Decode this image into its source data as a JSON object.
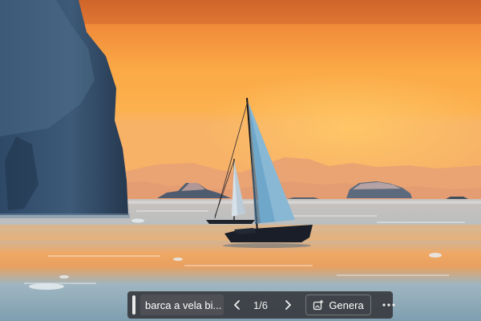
{
  "image": {
    "subject": "sailboat-at-sunset-among-icebergs",
    "colors": {
      "sky_top": "#e27a2f",
      "sky_glow": "#fbb24f",
      "mountains": "#e79a6e",
      "sea": "#9db3be",
      "iceberg": "#253a52"
    }
  },
  "toolbar": {
    "query_text": "barca a vela bi...",
    "prev_icon": "chevron-left-icon",
    "counter": "1/6",
    "next_icon": "chevron-right-icon",
    "generate_icon": "add-image-icon",
    "generate_label": "Genera",
    "more_icon": "more-horizontal-icon"
  }
}
